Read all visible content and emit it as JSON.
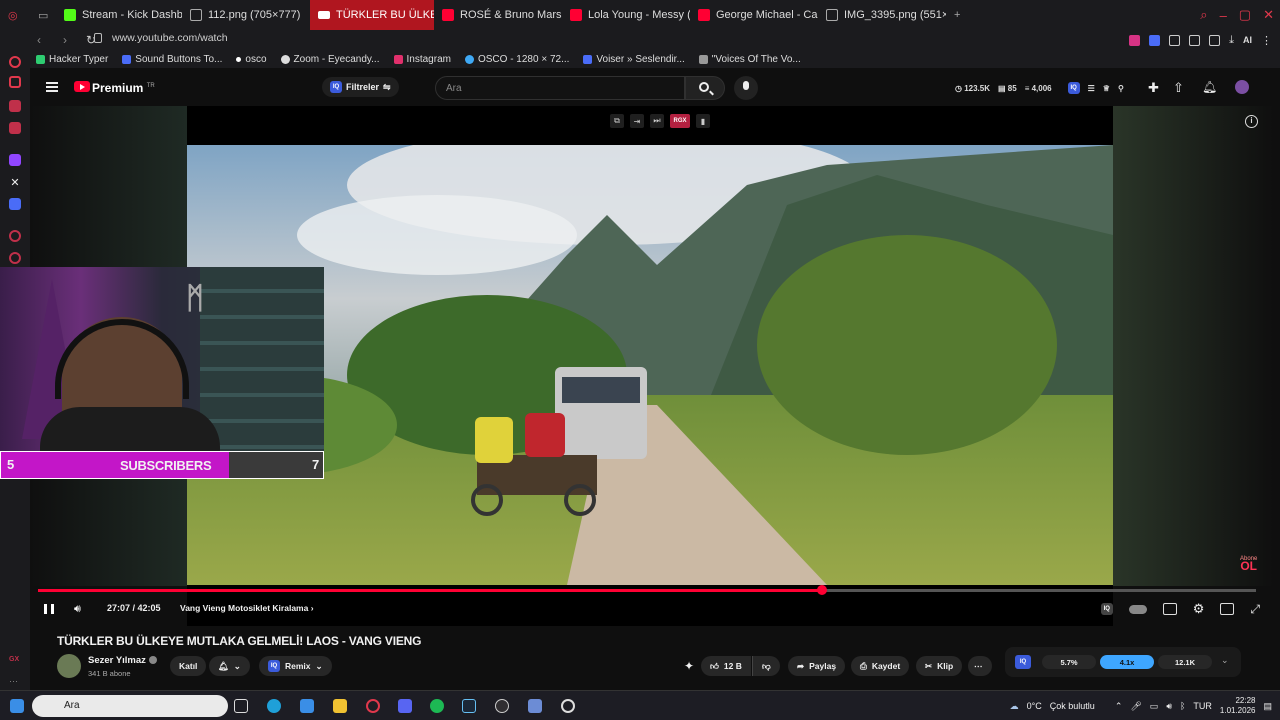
{
  "tabs": [
    {
      "label": "Stream - Kick Dashboard",
      "color": "#53fc18"
    },
    {
      "label": "112.png (705×777)",
      "color": "#888888"
    },
    {
      "label": "TÜRKLER BU ÜLKEYE",
      "color": "#ffffff",
      "active": true
    },
    {
      "label": "ROSÉ & Bruno Mars - APT",
      "color": "#ff0033"
    },
    {
      "label": "Lola Young - Messy (NOV",
      "color": "#ff0033"
    },
    {
      "label": "George Michael - Careles",
      "color": "#ff0033"
    },
    {
      "label": "IMG_3395.png (551×508)",
      "color": "#888888"
    }
  ],
  "address": {
    "url": "www.youtube.com/watch"
  },
  "extensions": {
    "ai_label": "AI"
  },
  "bookmarks": [
    {
      "label": "Hacker Typer",
      "color": "#2ecc71"
    },
    {
      "label": "Sound Buttons To...",
      "color": "#4a6cf7"
    },
    {
      "label": "osco",
      "color": "#ffffff"
    },
    {
      "label": "Zoom - Eyecandy...",
      "color": "#dddddd"
    },
    {
      "label": "Instagram",
      "color": "#e1306c"
    },
    {
      "label": "OSCO - 1280 × 72...",
      "color": "#3fa9f5"
    },
    {
      "label": "Voiser » Seslendir...",
      "color": "#4a6cf7"
    },
    {
      "label": "\"Voices Of The Vo...",
      "color": "#999999"
    }
  ],
  "header": {
    "brand": "Premium",
    "region": "TR",
    "filters_label": "Filtreler",
    "iq_badge": "IQ",
    "search_placeholder": "Ara",
    "stat_views": "123.5K",
    "stat_likes": "85",
    "stat_comments": "4,006"
  },
  "player": {
    "rgx_label": "RGX",
    "current_time": "27:07",
    "duration": "42:05",
    "time_display": "27:07 / 42:05",
    "progress_fraction": 0.644,
    "chapter": "Vang Vieng Motosiklet Kiralama",
    "subscribe_small": "Abone",
    "subscribe_big": "OL"
  },
  "webcam": {
    "left_count": "5",
    "label": "SUBSCRIBERS",
    "right_count": "7"
  },
  "video": {
    "title": "TÜRKLER BU ÜLKEYE MUTLAKA GELMELİ! LAOS - VANG VIENG",
    "channel": "Sezer Yılmaz",
    "subscribers": "341 B abone",
    "join_label": "Katıl",
    "remix_label": "Remix",
    "like_count": "12 B",
    "share_label": "Paylaş",
    "save_label": "Kaydet",
    "clip_label": "Klip"
  },
  "stats_widget": {
    "badge": "IQ",
    "value1": "5.7%",
    "value2": "4.1x",
    "value3": "12.1K"
  },
  "taskbar": {
    "search_placeholder": "Ara",
    "weather": "0°C",
    "weather_desc": "Çok bulutlu",
    "lang": "TUR",
    "time": "22:28",
    "date": "1.01.2026"
  }
}
